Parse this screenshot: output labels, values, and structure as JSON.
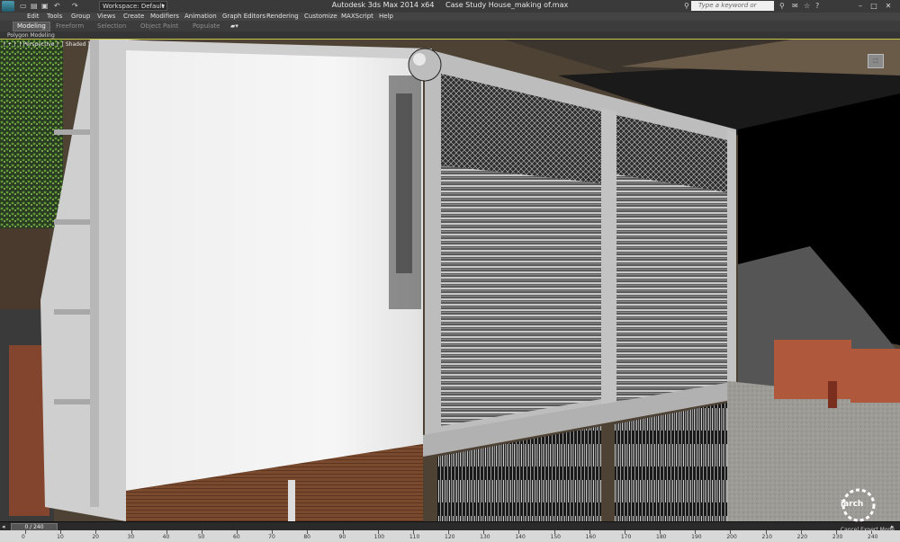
{
  "titlebar": {
    "workspace_label": "Workspace: Default",
    "app_title": "Autodesk 3ds Max  2014 x64",
    "file_title": "Case Study House_making of.max",
    "search_placeholder": "Type a keyword or phrase",
    "qa_icons": [
      "new-file-icon",
      "open-file-icon",
      "save-icon",
      "undo-icon",
      "redo-icon"
    ]
  },
  "menu": [
    "Edit",
    "Tools",
    "Group",
    "Views",
    "Create",
    "Modifiers",
    "Animation",
    "Graph Editors",
    "Rendering",
    "Customize",
    "MAXScript",
    "Help"
  ],
  "ribbon": {
    "tabs": [
      "Modeling",
      "Freeform",
      "Selection",
      "Object Paint",
      "Populate"
    ],
    "active_tab": "Modeling",
    "sub_label": "Polygon Modeling"
  },
  "viewport": {
    "label_parts": [
      "[ + ]",
      "[ Perspective ]",
      "[ Shaded ]"
    ]
  },
  "timeline": {
    "frame_display": "0 / 240",
    "ticks": [
      0,
      10,
      20,
      30,
      40,
      50,
      60,
      70,
      80,
      90,
      100,
      110,
      120,
      130,
      140,
      150,
      160,
      170,
      180,
      190,
      200,
      210,
      220,
      230,
      240
    ]
  },
  "status": {
    "cancel_expert": "Cancel Expert Mode"
  },
  "watermark": {
    "text": "iarch"
  },
  "colors": {
    "viewport_border": "#c8c846",
    "ui_dark": "#3a3a3a"
  }
}
